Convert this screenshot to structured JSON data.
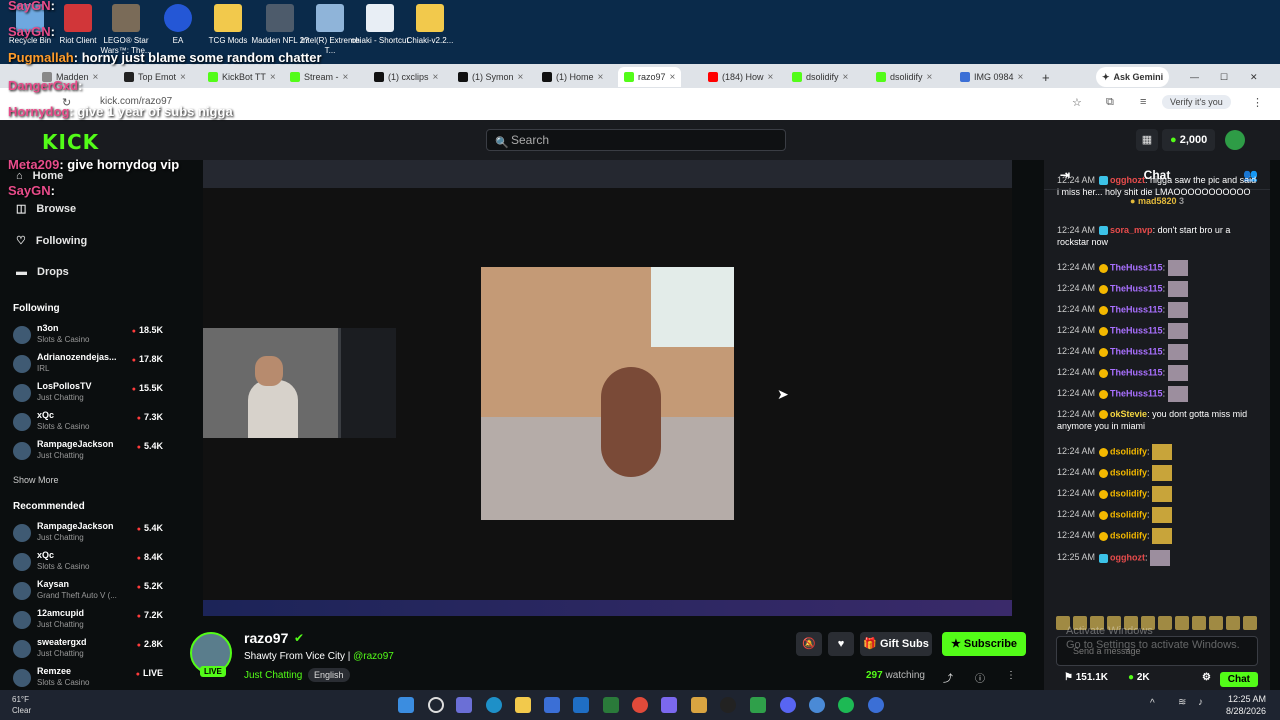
{
  "desktop": {
    "icons": [
      "Recycle Bin",
      "Riot Client",
      "LEGO® Star Wars™: The...",
      "EA",
      "TCG Mods",
      "Madden NFL 2?",
      "Intel(R) Extreme T...",
      "chiaki - Shortcut",
      "Chiaki-v2.2..."
    ]
  },
  "overlay_chat": [
    {
      "user": "SayGN",
      "text": ""
    },
    {
      "user": "SayGN",
      "text": ""
    },
    {
      "user": "Pugmallah",
      "text": "horny just blame some random chatter"
    },
    {
      "user": "DangerGxd",
      "text": ""
    },
    {
      "user": "Hornydog",
      "text": "give 1 year of subs nigga"
    },
    {
      "user": "Meta209",
      "text": "give hornydog vip"
    },
    {
      "user": "SayGN",
      "text": ""
    }
  ],
  "browser": {
    "tabs": [
      "Madden",
      "Top Emot",
      "KickBot TT",
      "Stream - ",
      "(1) cxclips",
      "(1) Symon",
      "(1) Home",
      "razo97",
      "(184) How",
      "dsolidify",
      "dsolidify",
      "IMG 0984"
    ],
    "ask_gemini": "Ask Gemini",
    "url": "kick.com/razo97",
    "verify": "Verify it's you"
  },
  "kick": {
    "logo": "KICK",
    "search_placeholder": "Search",
    "coins": "2,000",
    "nav": [
      "Home",
      "Browse",
      "Following",
      "Drops"
    ],
    "following_header": "Following",
    "following": [
      {
        "name": "n3on",
        "category": "Slots & Casino",
        "viewers": "18.5K"
      },
      {
        "name": "Adrianozendejas...",
        "category": "IRL",
        "viewers": "17.8K"
      },
      {
        "name": "LosPollosTV",
        "category": "Just Chatting",
        "viewers": "15.5K"
      },
      {
        "name": "xQc",
        "category": "Slots & Casino",
        "viewers": "7.3K"
      },
      {
        "name": "RampageJackson",
        "category": "Just Chatting",
        "viewers": "5.4K"
      }
    ],
    "show_more": "Show More",
    "recommended_header": "Recommended",
    "recommended": [
      {
        "name": "RampageJackson",
        "category": "Just Chatting",
        "viewers": "5.4K"
      },
      {
        "name": "xQc",
        "category": "Slots & Casino",
        "viewers": "8.4K"
      },
      {
        "name": "Kaysan",
        "category": "Grand Theft Auto V (...",
        "viewers": "5.2K"
      },
      {
        "name": "12amcupid",
        "category": "Just Chatting",
        "viewers": "7.2K"
      },
      {
        "name": "sweatergxd",
        "category": "Just Chatting",
        "viewers": "2.8K"
      },
      {
        "name": "Remzee",
        "category": "Slots & Casino",
        "viewers": "LIVE"
      }
    ],
    "stream": {
      "streamer": "razo97",
      "title": "Shawty From Vice City |",
      "handle": "@razo97",
      "category": "Just Chatting",
      "language": "English",
      "live": "LIVE",
      "gift_subs": "Gift Subs",
      "subscribe": "Subscribe",
      "watching_count": "297",
      "watching_label": "watching"
    },
    "chat": {
      "title": "Chat",
      "pinned_user": "mad5820",
      "pinned_count": "3",
      "messages": [
        {
          "time": "12:24 AM",
          "user": "ogghozt",
          "color": "#e84c4c",
          "text": "nigga saw the pic and said i miss her... holy shit die LMAOOOOOOOOOOO",
          "emote": ""
        },
        {
          "time": "12:24 AM",
          "user": "sora_mvp",
          "color": "#e84c4c",
          "text": "don't start bro ur a rockstar now",
          "emote": ""
        },
        {
          "time": "12:24 AM",
          "user": "TheHuss115",
          "color": "#a970ff",
          "text": "",
          "emote": "grey"
        },
        {
          "time": "12:24 AM",
          "user": "TheHuss115",
          "color": "#a970ff",
          "text": "",
          "emote": "grey"
        },
        {
          "time": "12:24 AM",
          "user": "TheHuss115",
          "color": "#a970ff",
          "text": "",
          "emote": "grey"
        },
        {
          "time": "12:24 AM",
          "user": "TheHuss115",
          "color": "#a970ff",
          "text": "",
          "emote": "grey"
        },
        {
          "time": "12:24 AM",
          "user": "TheHuss115",
          "color": "#a970ff",
          "text": "",
          "emote": "grey"
        },
        {
          "time": "12:24 AM",
          "user": "TheHuss115",
          "color": "#a970ff",
          "text": "",
          "emote": "grey"
        },
        {
          "time": "12:24 AM",
          "user": "TheHuss115",
          "color": "#a970ff",
          "text": "",
          "emote": "grey"
        },
        {
          "time": "12:24 AM",
          "user": "okStevie",
          "color": "#f5d742",
          "text": "you dont gotta miss mid anymore you in miami",
          "emote": ""
        },
        {
          "time": "12:24 AM",
          "user": "dsolidify",
          "color": "#f3b800",
          "text": "",
          "emote": "gold"
        },
        {
          "time": "12:24 AM",
          "user": "dsolidify",
          "color": "#f3b800",
          "text": "",
          "emote": "gold"
        },
        {
          "time": "12:24 AM",
          "user": "dsolidify",
          "color": "#f3b800",
          "text": "",
          "emote": "gold"
        },
        {
          "time": "12:24 AM",
          "user": "dsolidify",
          "color": "#f3b800",
          "text": "",
          "emote": "gold"
        },
        {
          "time": "12:24 AM",
          "user": "dsolidify",
          "color": "#f3b800",
          "text": "",
          "emote": "gold"
        },
        {
          "time": "12:25 AM",
          "user": "ogghozt",
          "color": "#e84c4c",
          "text": "",
          "emote": "grey"
        }
      ],
      "input_placeholder": "Send a message",
      "activate_line1": "Activate Windows",
      "activate_line2": "Go to Settings to activate Windows.",
      "followers": "151.1K",
      "subs": "2K",
      "chat_button": "Chat"
    }
  },
  "taskbar": {
    "temp": "61°F",
    "weather": "Clear",
    "time": "12:25 AM",
    "date": "8/28/2026"
  }
}
